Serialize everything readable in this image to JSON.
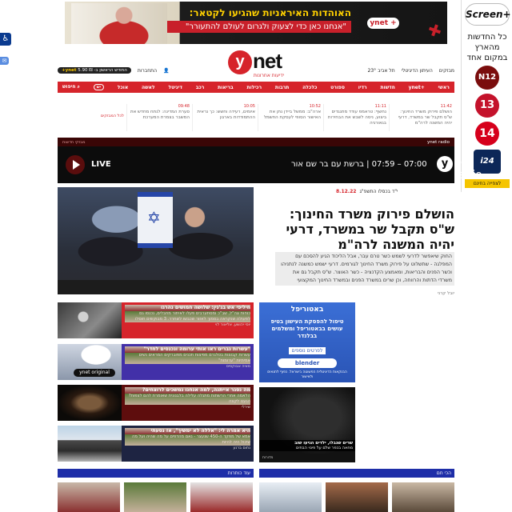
{
  "top_ad": {
    "line1": "האוהדות האיראניות שהגיעו לקטאר:",
    "line2": "\"אנחנו כאן כדי לצעוק ולגרום לעולם להתעורר\"",
    "logo": "ynet +"
  },
  "side_ad": {
    "brand": "Screen+",
    "text": "כל החדשות מהארץ במקום אחד",
    "ch12": "N12",
    "ch13": "13",
    "ch14": "14",
    "chi24": "i24",
    "button": "לצפייה בחינם"
  },
  "accessibility": {
    "icon": "accessibility-icon"
  },
  "logo": {
    "y": "y",
    "net": "net",
    "tagline": "ידיעות אחרונות"
  },
  "header": {
    "subscribe": "החודש הראשון ב-",
    "subscribe_price": "₪ 5.90",
    "subscribe_tag": "ynet+",
    "login": "התחברות",
    "sites": "מבזקים",
    "newspaper": "העיתון הדיגיטלי",
    "weather": "תל אביב 23°"
  },
  "nav": {
    "items": [
      "ראשי",
      "+ynet",
      "חדשות",
      "רדיו",
      "ספורט",
      "כלכלה",
      "תרבות",
      "רכילות",
      "בריאות",
      "רכב",
      "דיגיטל",
      "לאשה",
      "אוכל",
      "יש",
      "חיפוש"
    ]
  },
  "ticker": {
    "items": [
      {
        "time": "11:42",
        "text": "הושלם פירוק משרד החינוך: ש\"ס תקבל שר במשרד, דרעי יהיה המשנה לרה\"מ"
      },
      {
        "time": "11:11",
        "text": "נחשף: טראמפ עודד מתנגדים ביצוע, ניסה לשבש את הבחירות בגאורגיה"
      },
      {
        "time": "10:52",
        "text": "ארה\"ב: ממשל ביידן נתן את האישור הסופי לעסקת החשמל"
      },
      {
        "time": "10:05",
        "text": "איומים, רעידה וחשש: כך נראית ההתמודדות בארגון"
      },
      {
        "time": "09:48",
        "text": "סערת המדינה: לנתח מחדש את המשבר בצמרת המערכת"
      }
    ],
    "all": "לכל המבזקים"
  },
  "radio": {
    "header": "ynet radio",
    "ad_tag": "מבזקי חדשות",
    "live": "LIVE",
    "show": "07:00 – 07:59 | ברשת עם בר שם אור",
    "logo_text": "net radio"
  },
  "main": {
    "date": "8.12.22",
    "date_tag": "י\"ד בכסלו התשפ\"ג",
    "headline": "הושלם פירוק משרד החינוך: ש\"ס תקבל שר במשרד, דרעי יהיה המשנה לרה\"מ",
    "subtext": "החוק שיאפשר לדרעי לשמש כשר טרם עבר, אבל הליכוד הגיע להסכם עם המפלגה - שתשלוט על פירוק משרד החינוך לגורמים. דרעי ישמש כמשנה לנתניהו וכשר הפנים והבריאות, ומאמצע הקדנציה - כשר האוצר. ש\"ס תקבל גם את משרדי הדתות והרווחה, וכן שרים במשרד הפנים ובמשרד החינוך המקצועי",
    "author": "יובל קרני"
  },
  "stories": [
    {
      "title": "חיליפי אש בג'נין: שלושה חמושים נהרגו",
      "text": "כוחות צה\"ל, שב\"כ ומסתערבים פעלו לאיתור מחבלים, נכנסו גם לפעולה שנקראה בסמוך לאזור שכבשו לשחרר. 3 מבוקשים חוסלו",
      "by": "יוסי יהושע, אליאור לוי"
    },
    {
      "title": "\"עשרות גברים ראו אותי ערומה ונכנסים לחדר\"",
      "text": "עשרות קבוצות בטלגרם מפיצות תכנים מפוברקים המראים נשים אמיתיות \"ערומות\"",
      "by": "מאיה אבוקסיס"
    },
    {
      "title": "מה נסגר אייתנה, למה אנחנו נמשכים לרוצחים?",
      "text": "הלאמה אחרי הרשתות מתגלה עלילה בלבנונית שאומרת להם לצפות? הגענו לקצה",
      "by": "שירלי"
    },
    {
      "title": "היא אמרה לי: \"אללה לא ימשיך\", אז נסעתי",
      "text": "אמא של מפקד ה-450 שנעצר - נאם מהדפים על מה שהיה ועל מה שיכול היה להיות",
      "by": "נחום ברנע"
    }
  ],
  "mid_ad": {
    "brand": "באטוריפל",
    "headline": "טיפול להפסקת העישון בטיפ עושים בבאטוריפל ומשלמים בבלנדר",
    "button": "לפרטים נוספים",
    "blender": "blender",
    "small": "הבנקאות הדיגיטלית הפשוטה בישראל. כפוף לתנאים ולאישור"
  },
  "video": {
    "title": "שרים שנבלו, ילדים הגיעו שוב",
    "text": "מחאה בכפר שלם על פינוי הבתים",
    "label": "מדורות"
  },
  "sections": {
    "left": "עוד כותרות",
    "right": "הכי חם"
  }
}
